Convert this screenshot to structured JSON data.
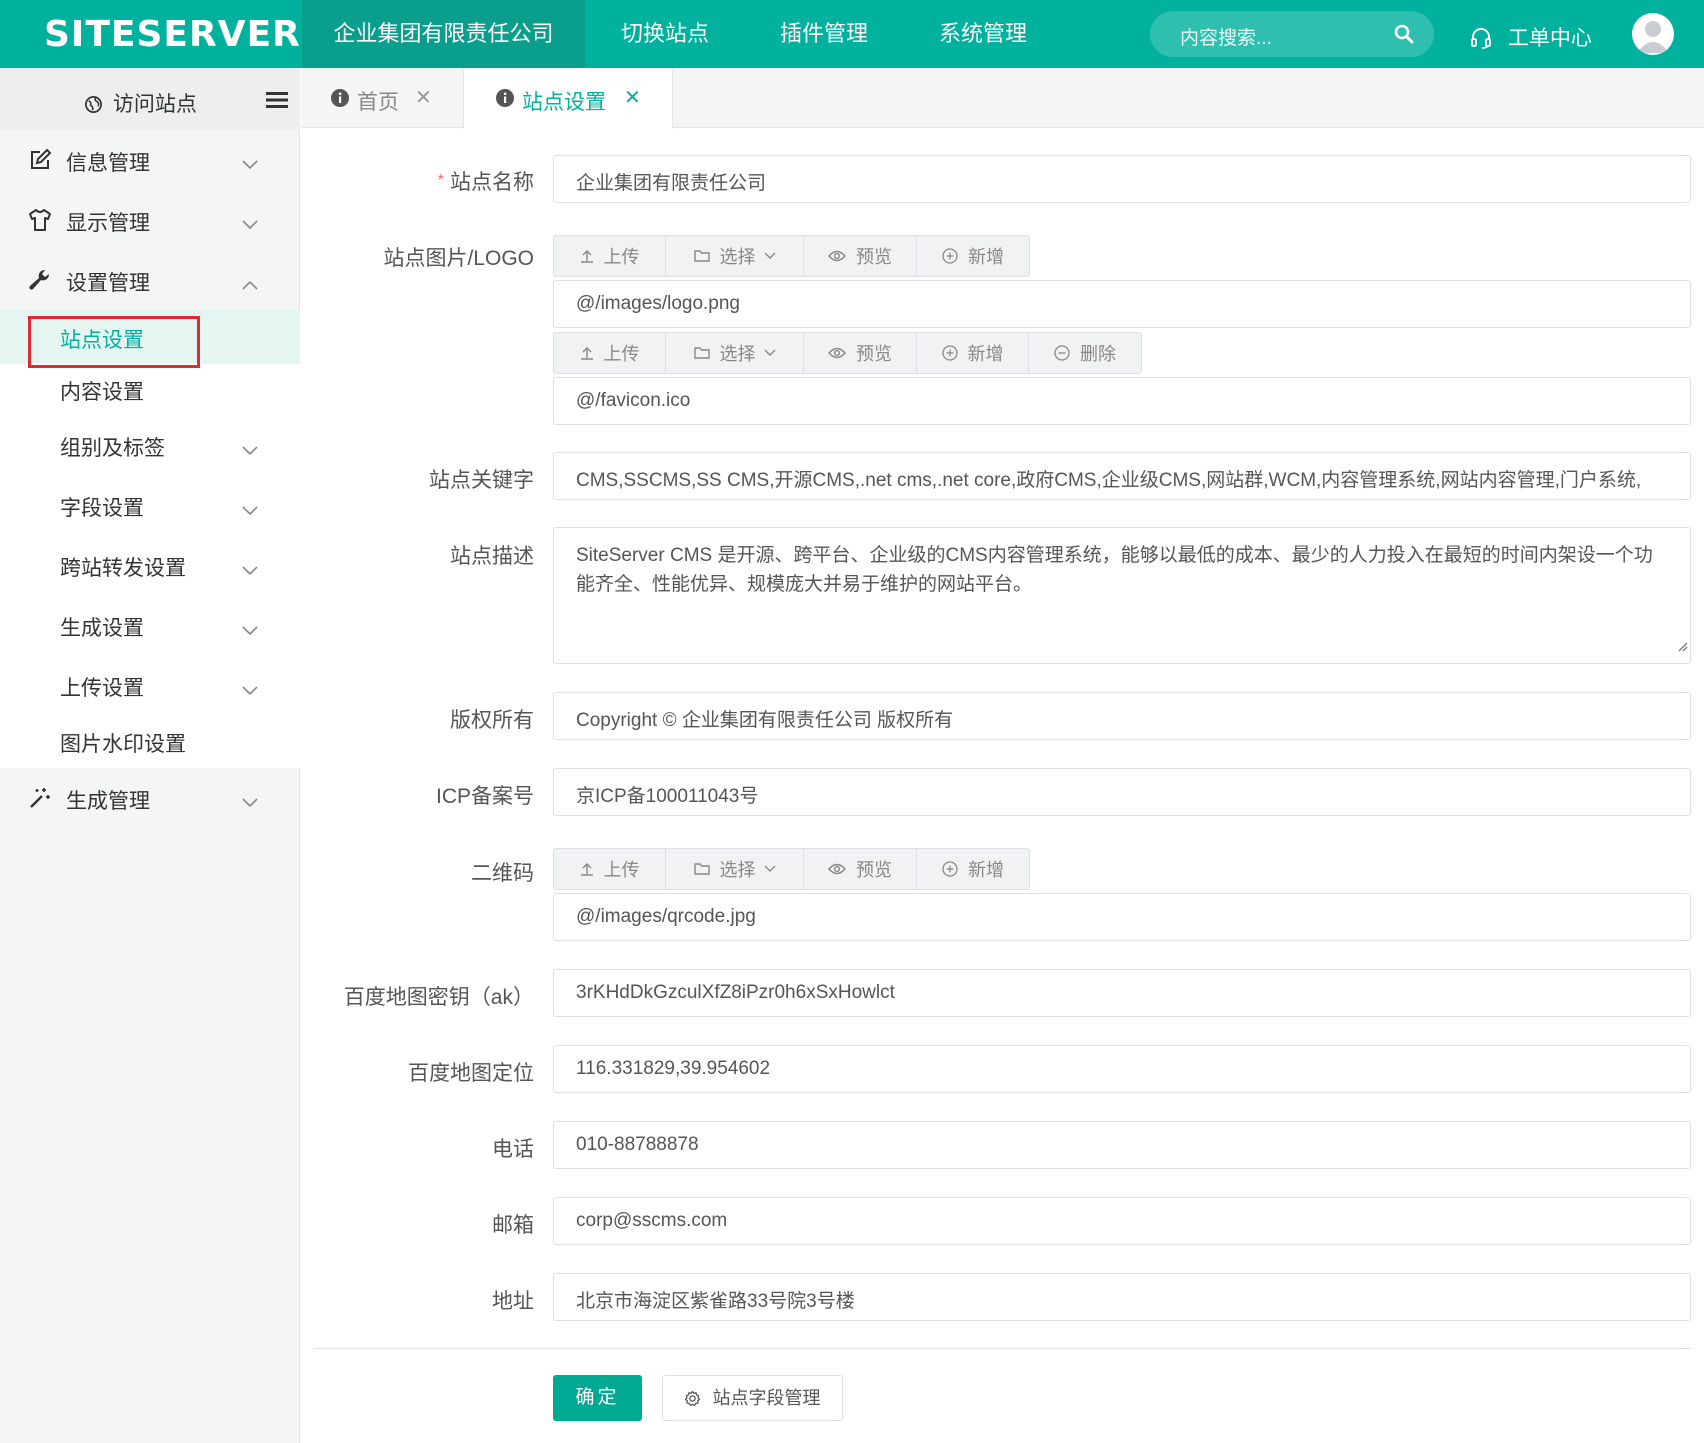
{
  "brand": {
    "logo": "SITESERVER",
    "accent": "#00b19d"
  },
  "topnav": {
    "items": [
      {
        "label": "企业集团有限责任公司",
        "active": true
      },
      {
        "label": "切换站点"
      },
      {
        "label": "插件管理"
      },
      {
        "label": "系统管理"
      }
    ],
    "search_placeholder": "内容搜索...",
    "workorder_label": "工单中心"
  },
  "sidebar": {
    "visit_label": "访问站点",
    "groups": [
      {
        "label": "信息管理",
        "icon": "edit-icon"
      },
      {
        "label": "显示管理",
        "icon": "shirt-icon"
      },
      {
        "label": "设置管理",
        "icon": "wrench-icon",
        "expanded": true
      },
      {
        "label": "生成管理",
        "icon": "magic-wand-icon"
      }
    ],
    "sub_items": [
      {
        "label": "站点设置",
        "active": true
      },
      {
        "label": "内容设置"
      },
      {
        "label": "组别及标签"
      },
      {
        "label": "字段设置"
      },
      {
        "label": "跨站转发设置"
      },
      {
        "label": "生成设置"
      },
      {
        "label": "上传设置"
      },
      {
        "label": "图片水印设置"
      }
    ]
  },
  "tabs": [
    {
      "label": "首页"
    },
    {
      "label": "站点设置",
      "active": true
    }
  ],
  "form": {
    "site_name": {
      "label": "站点名称",
      "value": "企业集团有限责任公司",
      "required_mark": "*"
    },
    "logo": {
      "label": "站点图片/LOGO",
      "logo_value": "@/images/logo.png",
      "favicon_value": "@/favicon.ico"
    },
    "upload_buttons": {
      "upload": "上传",
      "select": "选择",
      "preview": "预览",
      "add": "新增",
      "delete": "删除"
    },
    "keywords": {
      "label": "站点关键字",
      "value": "CMS,SSCMS,SS CMS,开源CMS,.net cms,.net core,政府CMS,企业级CMS,网站群,WCM,内容管理系统,网站内容管理,门户系统,"
    },
    "description": {
      "label": "站点描述",
      "value": "SiteServer CMS 是开源、跨平台、企业级的CMS内容管理系统，能够以最低的成本、最少的人力投入在最短的时间内架设一个功能齐全、性能优异、规模庞大并易于维护的网站平台。"
    },
    "copyright": {
      "label": "版权所有",
      "value": "Copyright © 企业集团有限责任公司  版权所有"
    },
    "icp": {
      "label": "ICP备案号",
      "value": "京ICP备100011043号"
    },
    "qrcode": {
      "label": "二维码",
      "value": "@/images/qrcode.jpg"
    },
    "baidu_ak": {
      "label": "百度地图密钥（ak）",
      "value": "3rKHdDkGzculXfZ8iPzr0h6xSxHowlct"
    },
    "baidu_loc": {
      "label": "百度地图定位",
      "value": "116.331829,39.954602"
    },
    "phone": {
      "label": "电话",
      "value": "010-88788878"
    },
    "email": {
      "label": "邮箱",
      "value": "corp@sscms.com"
    },
    "address": {
      "label": "地址",
      "value": "北京市海淀区紫雀路33号院3号楼"
    }
  },
  "actions": {
    "confirm": "确定",
    "field_manage": "站点字段管理"
  }
}
